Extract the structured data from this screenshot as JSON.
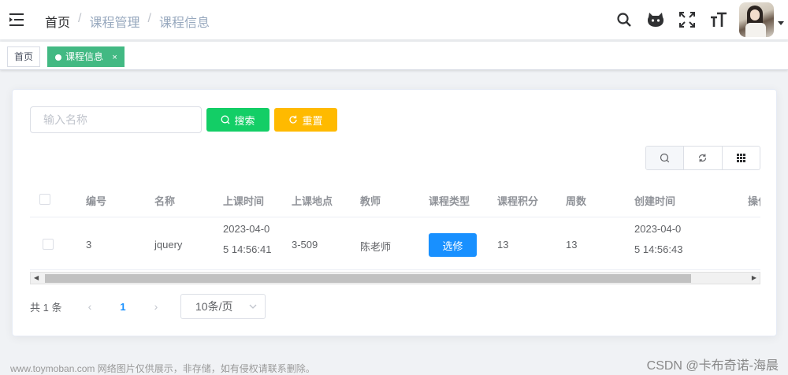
{
  "navbar": {
    "breadcrumb": [
      {
        "label": "首页"
      },
      {
        "label": "课程管理"
      },
      {
        "label": "课程信息"
      }
    ],
    "separator": "/",
    "icons": [
      "search-icon",
      "github-icon",
      "fullscreen-icon",
      "font-size-icon"
    ]
  },
  "tags": [
    {
      "label": "首页",
      "active": false
    },
    {
      "label": "课程信息",
      "active": true,
      "close": "×"
    }
  ],
  "search": {
    "placeholder": "输入名称",
    "search_label": "搜索",
    "reset_label": "重置"
  },
  "table": {
    "columns": [
      "编号",
      "名称",
      "上课时间",
      "上课地点",
      "教师",
      "课程类型",
      "课程积分",
      "周数",
      "创建时间",
      "操作"
    ],
    "rows": [
      {
        "id": "3",
        "name": "jquery",
        "time_line1": "2023-04-0",
        "time_line2": "5 14:56:41",
        "place": "3-509",
        "teacher": "陈老师",
        "type": "选修",
        "credit": "13",
        "weeks": "13",
        "created_line1": "2023-04-0",
        "created_line2": "5 14:56:43"
      }
    ]
  },
  "pagination": {
    "total": "共 1 条",
    "current_page": "1",
    "page_size": "10条/页"
  },
  "footer": {
    "watermark_left": "www.toymoban.com 网络图片仅供展示，非存储，如有侵权请联系删除。",
    "watermark_right": "CSDN @卡布奇诺-海晨"
  },
  "colors": {
    "tag_active": "#42b983",
    "search_button": "#13ce66",
    "reset_button": "#ffba00",
    "primary": "#1890ff"
  }
}
